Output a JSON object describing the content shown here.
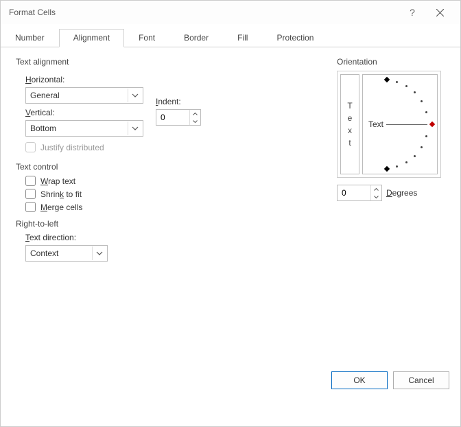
{
  "title": "Format Cells",
  "tabs": [
    "Number",
    "Alignment",
    "Font",
    "Border",
    "Fill",
    "Protection"
  ],
  "active_tab": "Alignment",
  "groups": {
    "textalign": "Text alignment",
    "textcontrol": "Text control",
    "rtl": "Right-to-left",
    "orientation": "Orientation"
  },
  "labels": {
    "horizontal": "Horizontal:",
    "vertical": "Vertical:",
    "indent": "Indent:",
    "justify": "Justify distributed",
    "wrap": "Wrap text",
    "shrink": "Shrink to fit",
    "merge": "Merge cells",
    "textdir": "Text direction:",
    "orient_text": "Text",
    "degrees": "Degrees"
  },
  "values": {
    "horizontal": "General",
    "vertical": "Bottom",
    "indent": "0",
    "textdir": "Context",
    "degrees": "0"
  },
  "buttons": {
    "ok": "OK",
    "cancel": "Cancel"
  }
}
